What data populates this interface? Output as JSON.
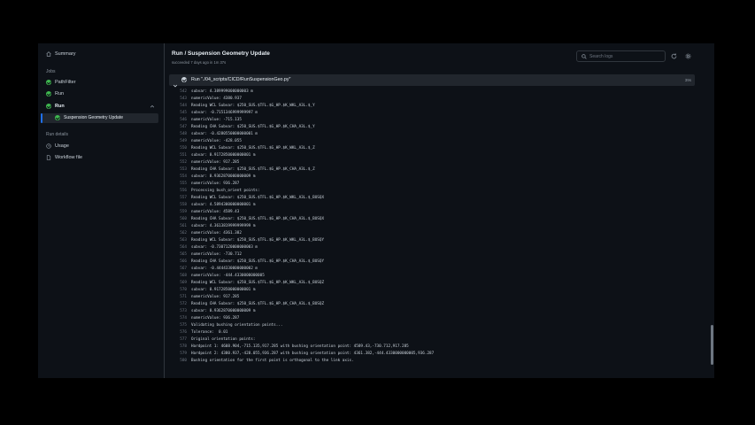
{
  "sidebar": {
    "summary_label": "Summary",
    "jobs_heading": "Jobs",
    "jobs": [
      {
        "label": "PathFilter",
        "status": "success"
      },
      {
        "label": "Run",
        "status": "success"
      },
      {
        "label": "Run",
        "status": "success",
        "expanded": true
      }
    ],
    "selected_step": "Suspension Geometry Update",
    "run_details_heading": "Run details",
    "usage_label": "Usage",
    "workflow_label": "Workflow file"
  },
  "header": {
    "title": "Run / Suspension Geometry Update",
    "subtitle": "succeeded 7 days ago in 1m 37s",
    "search_placeholder": "Search logs"
  },
  "step": {
    "title": "Run \"./04_scripts/CICD/RunSuspensionGeo.py\"",
    "duration": "39s"
  },
  "log": {
    "lines": [
      {
        "n": "541",
        "t": "Reading CHA Subvar: $250_SUS.$TFL.$G_HP.$K_CHA_A3L.$_X"
      },
      {
        "n": "542",
        "t": "subvar: 4.389999000000003 m"
      },
      {
        "n": "543",
        "t": "numericValue: 4380.937"
      },
      {
        "n": "544",
        "t": "Reading WCL Subvar: $250_SUS.$TFL.$G_HP.$K_WKL_A3L.$_Y"
      },
      {
        "n": "545",
        "t": "subvar: -0.7151346999999997 m"
      },
      {
        "n": "546",
        "t": "numericValue: -715.135"
      },
      {
        "n": "547",
        "t": "Reading CHA Subvar: $250_SUS.$TFL.$G_HP.$K_CHA_A3L.$_Y"
      },
      {
        "n": "548",
        "t": "subvar: -0.4280550000000001 m"
      },
      {
        "n": "549",
        "t": "numericValue: -428.055"
      },
      {
        "n": "550",
        "t": "Reading WCL Subvar: $250_SUS.$TFL.$G_HP.$K_WKL_A3L.$_Z"
      },
      {
        "n": "551",
        "t": "subvar: 0.9172850000000001 m"
      },
      {
        "n": "552",
        "t": "numericValue: 917.285"
      },
      {
        "n": "553",
        "t": "Reading CHA Subvar: $250_SUS.$TFL.$G_HP.$K_CHA_A3L.$_Z"
      },
      {
        "n": "554",
        "t": "subvar: 0.9362870000000009 m"
      },
      {
        "n": "555",
        "t": "numericValue: 936.287"
      },
      {
        "n": "556",
        "t": "Processing bush_orient points:"
      },
      {
        "n": "557",
        "t": "Reading WCL Subvar: $250_SUS.$TFL.$G_HP.$K_WKL_A3L.$_BUSQX"
      },
      {
        "n": "558",
        "t": "subvar: 4.5894300000000001 m"
      },
      {
        "n": "559",
        "t": "numericValue: 4589.43"
      },
      {
        "n": "560",
        "t": "Reading CHA Subvar: $250_SUS.$TFL.$G_HP.$K_CHA_A3L.$_BUSQX"
      },
      {
        "n": "561",
        "t": "subvar: 4.3613819999999999 m"
      },
      {
        "n": "562",
        "t": "numericValue: 4361.382"
      },
      {
        "n": "563",
        "t": "Reading WCL Subvar: $250_SUS.$TFL.$G_HP.$K_WKL_A3L.$_BUSQY"
      },
      {
        "n": "564",
        "t": "subvar: -0.7307120000000003 m"
      },
      {
        "n": "565",
        "t": "numericValue: -730.712"
      },
      {
        "n": "566",
        "t": "Reading CHA Subvar: $250_SUS.$TFL.$G_HP.$K_CHA_A3L.$_BUSQY"
      },
      {
        "n": "567",
        "t": "subvar: -0.4444330000000002 m"
      },
      {
        "n": "568",
        "t": "numericValue: -444.4330000000005"
      },
      {
        "n": "569",
        "t": "Reading WCL Subvar: $250_SUS.$TFL.$G_HP.$K_WKL_A3L.$_BUSQZ"
      },
      {
        "n": "570",
        "t": "subvar: 0.9172850000000001 m"
      },
      {
        "n": "571",
        "t": "numericValue: 917.285"
      },
      {
        "n": "572",
        "t": "Reading CHA Subvar: $250_SUS.$TFL.$G_HP.$K_CHA_A3L.$_BUSQZ"
      },
      {
        "n": "573",
        "t": "subvar: 0.9362870000000009 m"
      },
      {
        "n": "574",
        "t": "numericValue: 936.287"
      },
      {
        "n": "575",
        "t": "Validating bushing orientation points..."
      },
      {
        "n": "576",
        "t": "Tolerance:  0.01"
      },
      {
        "n": "577",
        "t": "Original orientation points:"
      },
      {
        "n": "578",
        "t": "Hardpoint 1: 4608.904,-715.135,917.285 with bushing orientation point: 4589.43,-730.712,917.285"
      },
      {
        "n": "579",
        "t": "Hardpoint 2: 4380.937,-428.055,936.287 with bushing orientation point: 4361.382,-444.4330000000005,936.287"
      },
      {
        "n": "580",
        "t": "Bushing orientation for the first point is orthogonal to the link axis."
      }
    ]
  },
  "colors": {
    "app_bg": "#0d1117",
    "border": "#30363d",
    "success": "#3fb950",
    "accent": "#1f6feb",
    "text": "#c9d1d9",
    "muted": "#8b949e"
  },
  "icons": [
    "home-icon",
    "success-check-icon",
    "clock-icon",
    "file-icon",
    "search-icon",
    "refresh-icon",
    "gear-icon",
    "chevron-down-icon"
  ]
}
